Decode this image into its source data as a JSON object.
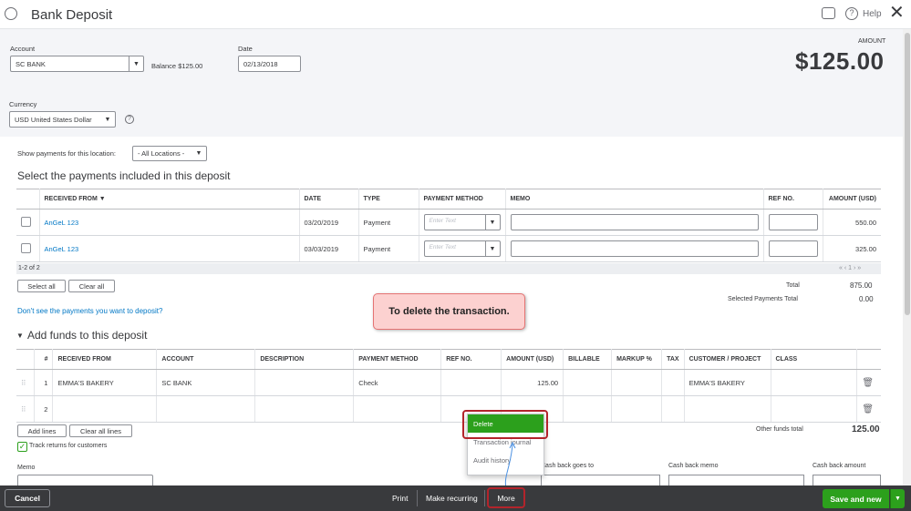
{
  "header": {
    "title": "Bank Deposit",
    "help": "Help"
  },
  "account": {
    "label": "Account",
    "value": "SC BANK",
    "balance_label": "Balance",
    "balance": "$125.00"
  },
  "date": {
    "label": "Date",
    "value": "02/13/2018"
  },
  "amount": {
    "label": "AMOUNT",
    "value": "$125.00"
  },
  "currency": {
    "label": "Currency",
    "value": "USD United States Dollar"
  },
  "location": {
    "label": "Show payments for this location:",
    "value": "- All Locations -"
  },
  "payments": {
    "heading": "Select the payments included in this deposit",
    "columns": [
      "RECEIVED FROM ▼",
      "DATE",
      "TYPE",
      "PAYMENT METHOD",
      "MEMO",
      "REF NO.",
      "AMOUNT (USD)"
    ],
    "rows": [
      {
        "received_from": "AnGeL 123",
        "date": "03/20/2019",
        "type": "Payment",
        "method_placeholder": "Enter Text",
        "amount": "550.00"
      },
      {
        "received_from": "AnGeL 123",
        "date": "03/03/2019",
        "type": "Payment",
        "method_placeholder": "Enter Text",
        "amount": "325.00"
      }
    ],
    "count": "1-2 of 2",
    "pager": "« ‹ 1 › »",
    "select_all": "Select all",
    "clear_all": "Clear all",
    "total_label": "Total",
    "total": "875.00",
    "selected_label": "Selected Payments Total",
    "selected_total": "0.00",
    "help_link": "Don't see the payments you want to deposit?"
  },
  "callout": "To delete the transaction.",
  "funds": {
    "heading": "Add funds to this deposit",
    "columns": [
      "#",
      "RECEIVED FROM",
      "ACCOUNT",
      "DESCRIPTION",
      "PAYMENT METHOD",
      "REF NO.",
      "AMOUNT (USD)",
      "BILLABLE",
      "MARKUP %",
      "TAX",
      "CUSTOMER / PROJECT",
      "CLASS"
    ],
    "rows": [
      {
        "num": "1",
        "received_from": "EMMA'S BAKERY",
        "account": "SC BANK",
        "method": "Check",
        "amount": "125.00",
        "customer": "EMMA'S BAKERY"
      },
      {
        "num": "2",
        "received_from": "",
        "account": "",
        "method": "",
        "amount": "",
        "customer": ""
      }
    ],
    "add_lines": "Add lines",
    "clear_all_lines": "Clear all lines",
    "other_total_label": "Other funds total",
    "other_total": "125.00",
    "track_returns": "Track returns for customers"
  },
  "memo_label": "Memo",
  "cash_back": {
    "goes_to": "Cash back goes to",
    "memo": "Cash back memo",
    "amount": "Cash back amount"
  },
  "more_menu": [
    "Delete",
    "Transaction journal",
    "Audit history"
  ],
  "footer": {
    "cancel": "Cancel",
    "print": "Print",
    "make_recurring": "Make recurring",
    "more": "More",
    "save_new": "Save and new"
  }
}
